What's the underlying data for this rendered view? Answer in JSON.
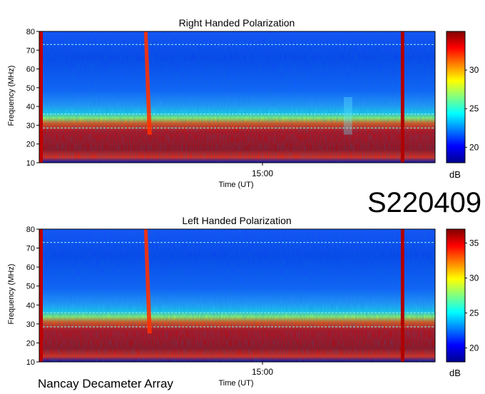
{
  "station_code": "S220409",
  "footer": "Nancay Decameter Array",
  "colormap": [
    "#00008f",
    "#0000ff",
    "#0080ff",
    "#00ffff",
    "#80ff80",
    "#ffff00",
    "#ff8000",
    "#ff0000",
    "#800000"
  ],
  "chart_data": [
    {
      "type": "heatmap",
      "title": "Right Handed Polarization",
      "xlabel": "Time (UT)",
      "ylabel": "Frequency (MHz)",
      "x_tick_labels": [
        "15:00"
      ],
      "y_ticks": [
        10,
        20,
        30,
        40,
        50,
        60,
        70,
        80
      ],
      "ylim": [
        10,
        80
      ],
      "colorbar": {
        "label": "dB",
        "ticks": [
          20,
          25,
          30
        ],
        "range": [
          18,
          35
        ]
      },
      "features": [
        {
          "name": "type III burst",
          "time_fraction": 0.27,
          "freq_range_mhz": [
            25,
            80
          ]
        },
        {
          "name": "broadband interference",
          "time_fraction": 0.917,
          "freq_range_mhz": [
            10,
            80
          ]
        },
        {
          "name": "faint bursts",
          "time_fraction": 0.78,
          "freq_range_mhz": [
            25,
            45
          ]
        }
      ],
      "grid": false
    },
    {
      "type": "heatmap",
      "title": "Left Handed Polarization",
      "xlabel": "Time (UT)",
      "ylabel": "Frequency (MHz)",
      "x_tick_labels": [
        "15:00"
      ],
      "y_ticks": [
        10,
        20,
        30,
        40,
        50,
        60,
        70,
        80
      ],
      "ylim": [
        10,
        80
      ],
      "colorbar": {
        "label": "dB",
        "ticks": [
          20,
          25,
          30,
          35
        ],
        "range": [
          18,
          37
        ]
      },
      "features": [
        {
          "name": "type III burst",
          "time_fraction": 0.27,
          "freq_range_mhz": [
            25,
            80
          ]
        },
        {
          "name": "broadband interference",
          "time_fraction": 0.917,
          "freq_range_mhz": [
            10,
            80
          ]
        }
      ],
      "grid": false
    }
  ]
}
